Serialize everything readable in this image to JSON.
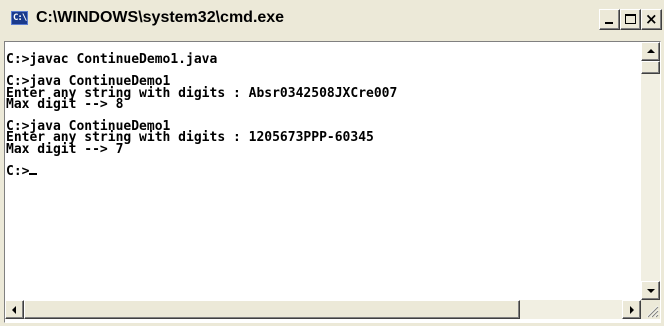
{
  "window": {
    "title": "C:\\WINDOWS\\system32\\cmd.exe",
    "icon": "cmd-icon",
    "icon_glyph": "C:\\",
    "controls": {
      "minimize_icon": "minimize-icon",
      "maximize_icon": "maximize-icon",
      "close_icon": "close-icon",
      "close_glyph": "×"
    }
  },
  "console": {
    "lines": [
      "C:>javac ContinueDemo1.java",
      "",
      "C:>java ContinueDemo1",
      "Enter any string with digits : Absr0342508JXCre007",
      "Max digit --> 8",
      "",
      "C:>java ContinueDemo1",
      "Enter any string with digits : 1205673PPP-60345",
      "Max digit --> 7",
      "",
      "C:>"
    ],
    "cursor_visible": true
  },
  "colors": {
    "console_background": "#ffffff",
    "console_text": "#000000",
    "chrome": "#ece9d8"
  }
}
